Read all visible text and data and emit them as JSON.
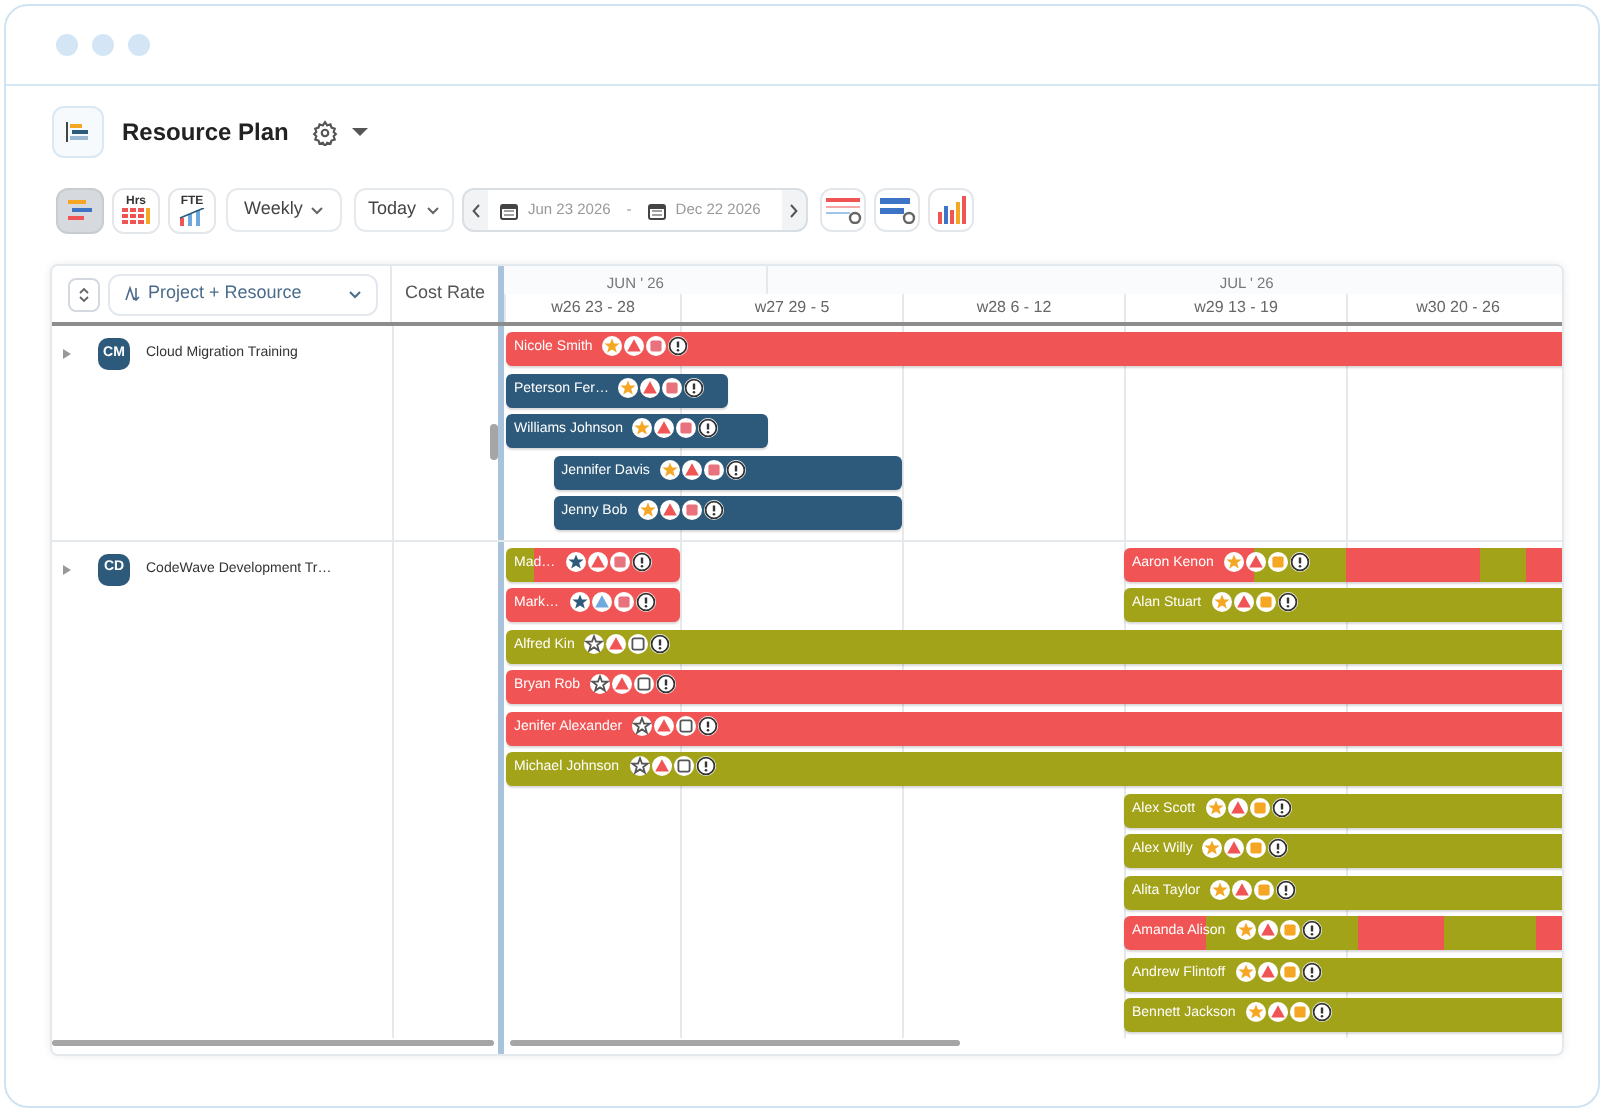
{
  "header": {
    "title": "Resource Plan"
  },
  "toolbar": {
    "views": [
      {
        "kind": "gantt",
        "selected": true
      },
      {
        "kind": "hours",
        "label": "Hrs",
        "selected": false
      },
      {
        "kind": "fte",
        "label": "FTE",
        "selected": false
      }
    ],
    "period": {
      "value": "Weekly"
    },
    "jump": {
      "value": "Today"
    },
    "date_range": {
      "start": "Jun 23 2026",
      "separator": "-",
      "end": "Dec 22 2026"
    },
    "tools": [
      {
        "kind": "gantt-settings"
      },
      {
        "kind": "rows-settings"
      },
      {
        "kind": "bar-chart"
      }
    ]
  },
  "grid": {
    "group_by": {
      "label": "Project + Resource"
    },
    "columns": [
      {
        "label": "Cost Rate"
      }
    ],
    "months": [
      {
        "label": "JUN ' 26"
      },
      {
        "label": "JUL ' 26"
      }
    ],
    "weeks": [
      {
        "label": "w26 23 - 28"
      },
      {
        "label": "w27 29 - 5"
      },
      {
        "label": "w28 6 - 12"
      },
      {
        "label": "w29 13 - 19"
      },
      {
        "label": "w30 20 - 26"
      }
    ],
    "groups": [
      {
        "code": "CM",
        "name": "Cloud Migration Training",
        "rows": [
          {
            "bars": [
              {
                "name": "Nicole Smith",
                "color": "#f05454",
                "badges": [
                  {
                    "kind": "star",
                    "color": "#f5a623",
                    "filled": true
                  },
                  {
                    "kind": "triangle",
                    "color": "#f05454",
                    "filled": true
                  },
                  {
                    "kind": "square",
                    "color": "#e8737f",
                    "filled": true
                  },
                  {
                    "kind": "alert"
                  }
                ]
              }
            ]
          },
          {
            "bars": [
              {
                "name": "Peterson Fer…",
                "color": "#2d5a7b",
                "badges": [
                  {
                    "kind": "star",
                    "color": "#f5a623",
                    "filled": true
                  },
                  {
                    "kind": "triangle",
                    "color": "#f05454",
                    "filled": true
                  },
                  {
                    "kind": "square",
                    "color": "#e8737f",
                    "filled": true
                  },
                  {
                    "kind": "alert"
                  }
                ]
              }
            ]
          },
          {
            "bars": [
              {
                "name": "Williams Johnson",
                "color": "#2d5a7b",
                "badges": [
                  {
                    "kind": "star",
                    "color": "#f5a623",
                    "filled": true
                  },
                  {
                    "kind": "triangle",
                    "color": "#f05454",
                    "filled": true
                  },
                  {
                    "kind": "square",
                    "color": "#e8737f",
                    "filled": true
                  },
                  {
                    "kind": "alert"
                  }
                ]
              }
            ]
          },
          {
            "bars": [
              {
                "name": "Jennifer Davis",
                "color": "#2d5a7b",
                "badges": [
                  {
                    "kind": "star",
                    "color": "#f5a623",
                    "filled": true
                  },
                  {
                    "kind": "triangle",
                    "color": "#f05454",
                    "filled": true
                  },
                  {
                    "kind": "square",
                    "color": "#e8737f",
                    "filled": true
                  },
                  {
                    "kind": "alert"
                  }
                ]
              }
            ]
          },
          {
            "bars": [
              {
                "name": "Jenny Bob",
                "color": "#2d5a7b",
                "badges": [
                  {
                    "kind": "star",
                    "color": "#f5a623",
                    "filled": true
                  },
                  {
                    "kind": "triangle",
                    "color": "#f05454",
                    "filled": true
                  },
                  {
                    "kind": "square",
                    "color": "#e8737f",
                    "filled": true
                  },
                  {
                    "kind": "alert"
                  }
                ]
              }
            ]
          }
        ]
      },
      {
        "code": "CD",
        "name": "CodeWave Development Tr…",
        "rows": [
          {
            "bars": [
              {
                "name": "Mad…",
                "color": "#f05454",
                "segments": [
                  {
                    "color": "#a3a31a"
                  }
                ],
                "badges": [
                  {
                    "kind": "star",
                    "color": "#2d5a7b",
                    "filled": true
                  },
                  {
                    "kind": "triangle",
                    "color": "#f05454",
                    "filled": true
                  },
                  {
                    "kind": "square",
                    "color": "#e8737f",
                    "filled": true
                  },
                  {
                    "kind": "alert"
                  }
                ]
              },
              {
                "name": "Aaron Kenon",
                "color": "#f05454",
                "segments": [
                  {
                    "color": "#f05454"
                  },
                  {
                    "color": "#a3a31a"
                  },
                  {
                    "color": "#f05454"
                  },
                  {
                    "color": "#a3a31a"
                  }
                ],
                "badges": [
                  {
                    "kind": "star",
                    "color": "#f5a623",
                    "filled": true
                  },
                  {
                    "kind": "triangle",
                    "color": "#f05454",
                    "filled": true
                  },
                  {
                    "kind": "square",
                    "color": "#f5a623",
                    "filled": true
                  },
                  {
                    "kind": "alert"
                  }
                ]
              }
            ]
          },
          {
            "bars": [
              {
                "name": "Mark…",
                "color": "#f05454",
                "badges": [
                  {
                    "kind": "star",
                    "color": "#2d5a7b",
                    "filled": true
                  },
                  {
                    "kind": "triangle",
                    "color": "#6fa8dc",
                    "filled": true
                  },
                  {
                    "kind": "square",
                    "color": "#e8737f",
                    "filled": true
                  },
                  {
                    "kind": "alert"
                  }
                ]
              },
              {
                "name": "Alan Stuart",
                "color": "#a3a31a",
                "badges": [
                  {
                    "kind": "star",
                    "color": "#f5a623",
                    "filled": true
                  },
                  {
                    "kind": "triangle",
                    "color": "#f05454",
                    "filled": true
                  },
                  {
                    "kind": "square",
                    "color": "#f5a623",
                    "filled": true
                  },
                  {
                    "kind": "alert"
                  }
                ]
              }
            ]
          },
          {
            "bars": [
              {
                "name": "Alfred Kin",
                "color": "#a3a31a",
                "badges": [
                  {
                    "kind": "star",
                    "filled": false
                  },
                  {
                    "kind": "triangle",
                    "color": "#f05454",
                    "filled": true
                  },
                  {
                    "kind": "square",
                    "filled": false
                  },
                  {
                    "kind": "alert"
                  }
                ]
              }
            ]
          },
          {
            "bars": [
              {
                "name": "Bryan Rob",
                "color": "#f05454",
                "badges": [
                  {
                    "kind": "star",
                    "filled": false
                  },
                  {
                    "kind": "triangle",
                    "color": "#f05454",
                    "filled": true
                  },
                  {
                    "kind": "square",
                    "filled": false
                  },
                  {
                    "kind": "alert"
                  }
                ]
              }
            ]
          },
          {
            "bars": [
              {
                "name": "Jenifer Alexander",
                "color": "#f05454",
                "badges": [
                  {
                    "kind": "star",
                    "filled": false
                  },
                  {
                    "kind": "triangle",
                    "color": "#f05454",
                    "filled": true
                  },
                  {
                    "kind": "square",
                    "filled": false
                  },
                  {
                    "kind": "alert"
                  }
                ]
              }
            ]
          },
          {
            "bars": [
              {
                "name": "Michael Johnson",
                "color": "#a3a31a",
                "badges": [
                  {
                    "kind": "star",
                    "filled": false
                  },
                  {
                    "kind": "triangle",
                    "color": "#f05454",
                    "filled": true
                  },
                  {
                    "kind": "square",
                    "filled": false
                  },
                  {
                    "kind": "alert"
                  }
                ]
              }
            ]
          },
          {
            "bars": [
              {
                "name": "Alex Scott",
                "color": "#a3a31a",
                "badges": [
                  {
                    "kind": "star",
                    "color": "#f5a623",
                    "filled": true
                  },
                  {
                    "kind": "triangle",
                    "color": "#f05454",
                    "filled": true
                  },
                  {
                    "kind": "square",
                    "color": "#f5a623",
                    "filled": true
                  },
                  {
                    "kind": "alert"
                  }
                ]
              }
            ]
          },
          {
            "bars": [
              {
                "name": "Alex Willy",
                "color": "#a3a31a",
                "badges": [
                  {
                    "kind": "star",
                    "color": "#f5a623",
                    "filled": true
                  },
                  {
                    "kind": "triangle",
                    "color": "#f05454",
                    "filled": true
                  },
                  {
                    "kind": "square",
                    "color": "#f5a623",
                    "filled": true
                  },
                  {
                    "kind": "alert"
                  }
                ]
              }
            ]
          },
          {
            "bars": [
              {
                "name": "Alita Taylor",
                "color": "#a3a31a",
                "badges": [
                  {
                    "kind": "star",
                    "color": "#f5a623",
                    "filled": true
                  },
                  {
                    "kind": "triangle",
                    "color": "#f05454",
                    "filled": true
                  },
                  {
                    "kind": "square",
                    "color": "#f5a623",
                    "filled": true
                  },
                  {
                    "kind": "alert"
                  }
                ]
              }
            ]
          },
          {
            "bars": [
              {
                "name": "Amanda Alison",
                "color": "#f05454",
                "segments": [
                  {
                    "color": "#f05454"
                  },
                  {
                    "color": "#a3a31a"
                  },
                  {
                    "color": "#f05454"
                  },
                  {
                    "color": "#a3a31a"
                  }
                ],
                "badges": [
                  {
                    "kind": "star",
                    "color": "#f5a623",
                    "filled": true
                  },
                  {
                    "kind": "triangle",
                    "color": "#f05454",
                    "filled": true
                  },
                  {
                    "kind": "square",
                    "color": "#f5a623",
                    "filled": true
                  },
                  {
                    "kind": "alert"
                  }
                ]
              }
            ]
          },
          {
            "bars": [
              {
                "name": "Andrew Flintoff",
                "color": "#a3a31a",
                "badges": [
                  {
                    "kind": "star",
                    "color": "#f5a623",
                    "filled": true
                  },
                  {
                    "kind": "triangle",
                    "color": "#f05454",
                    "filled": true
                  },
                  {
                    "kind": "square",
                    "color": "#f5a623",
                    "filled": true
                  },
                  {
                    "kind": "alert"
                  }
                ]
              }
            ]
          },
          {
            "bars": [
              {
                "name": "Bennett Jackson",
                "color": "#a3a31a",
                "badges": [
                  {
                    "kind": "star",
                    "color": "#f5a623",
                    "filled": true
                  },
                  {
                    "kind": "triangle",
                    "color": "#f05454",
                    "filled": true
                  },
                  {
                    "kind": "square",
                    "color": "#f5a623",
                    "filled": true
                  },
                  {
                    "kind": "alert"
                  }
                ]
              }
            ]
          }
        ]
      }
    ]
  }
}
